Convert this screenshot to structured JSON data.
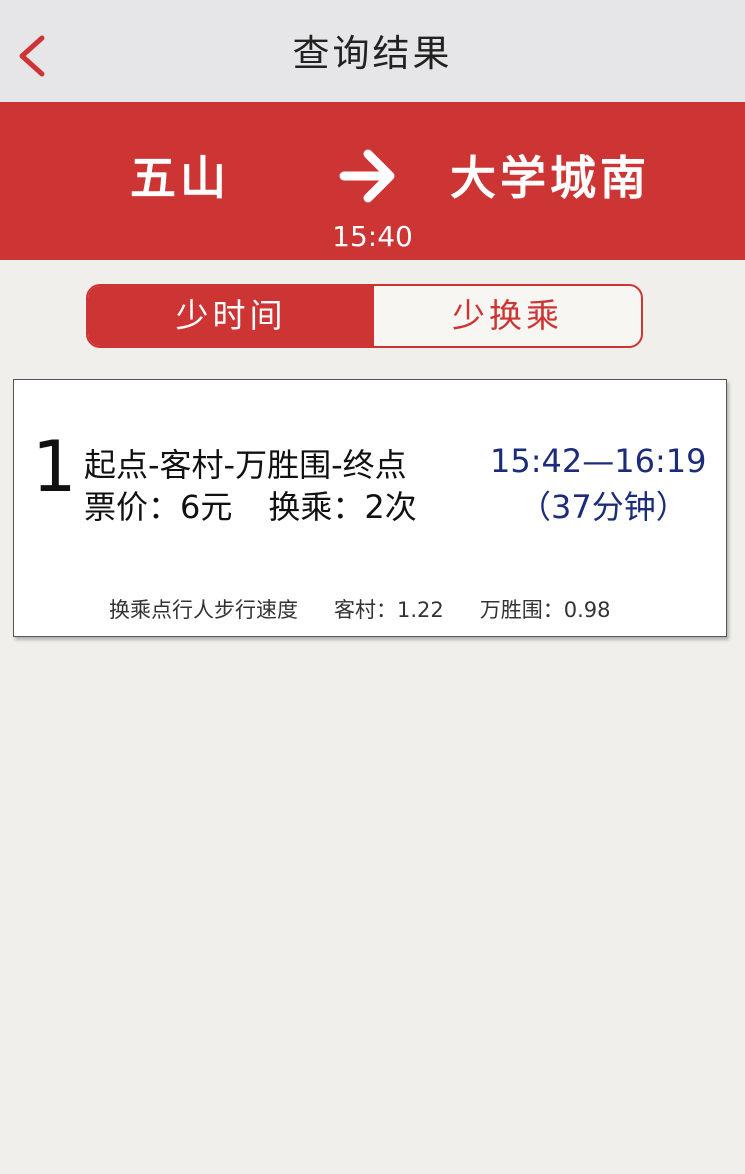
{
  "nav": {
    "title": "查询结果"
  },
  "route": {
    "from": "五山",
    "to": "大学城南",
    "depart_time": "15:40"
  },
  "tabs": [
    {
      "label": "少时间",
      "active": true
    },
    {
      "label": "少换乘",
      "active": false
    }
  ],
  "results": [
    {
      "index": "1",
      "path": "起点-客村-万胜围-终点",
      "fare_label": "票价：",
      "fare_value": "6元",
      "transfer_label": "换乘：",
      "transfer_value": "2次",
      "time_range": "15:42—16:19",
      "duration": "（37分钟）",
      "walk_speed_label": "换乘点行人步行速度",
      "walk_points": [
        {
          "name_label": "客村：",
          "value": "1.22"
        },
        {
          "name_label": "万胜围：",
          "value": "0.98"
        }
      ]
    }
  ],
  "colors": {
    "accent": "#cd3434",
    "time_text": "#1c2c7a",
    "nav_bg": "#e6e5e7",
    "page_bg": "#f0efeb"
  },
  "icons": {
    "back": "chevron-left-icon",
    "direction": "arrow-right-icon"
  }
}
